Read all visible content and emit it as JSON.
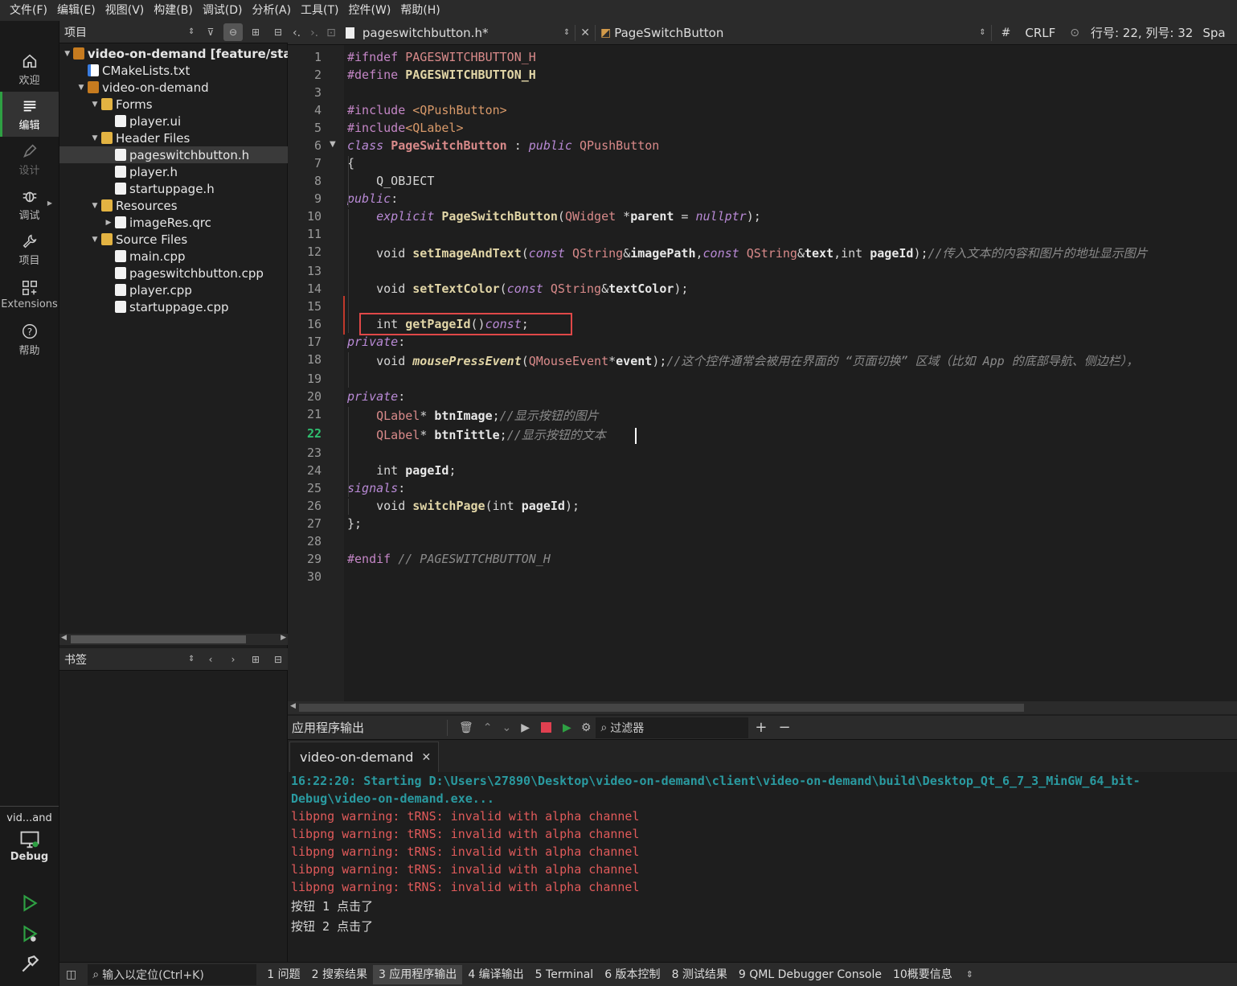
{
  "menubar": [
    "文件(F)",
    "编辑(E)",
    "视图(V)",
    "构建(B)",
    "调试(D)",
    "分析(A)",
    "工具(T)",
    "控件(W)",
    "帮助(H)"
  ],
  "modes": {
    "welcome": "欢迎",
    "edit": "编辑",
    "design": "设计",
    "debug": "调试",
    "project": "项目",
    "extensions": "Extensions",
    "help": "帮助"
  },
  "kit": {
    "name": "vid...and",
    "build": "Debug"
  },
  "project_panel": {
    "title": "项目",
    "tree": [
      {
        "label": "video-on-demand [feature/star",
        "icon": "project-icon",
        "depth": 0,
        "twisty": "▼",
        "bold": true
      },
      {
        "label": "CMakeLists.txt",
        "icon": "cmake-icon",
        "depth": 1,
        "twisty": ""
      },
      {
        "label": "video-on-demand",
        "icon": "hammer-icon",
        "depth": 1,
        "twisty": "▼"
      },
      {
        "label": "Forms",
        "icon": "folder-icon",
        "depth": 2,
        "twisty": "▼"
      },
      {
        "label": "player.ui",
        "icon": "file-icon",
        "depth": 3,
        "twisty": ""
      },
      {
        "label": "Header Files",
        "icon": "folder-icon",
        "depth": 2,
        "twisty": "▼"
      },
      {
        "label": "pageswitchbutton.h",
        "icon": "file-icon",
        "depth": 3,
        "twisty": "",
        "selected": true
      },
      {
        "label": "player.h",
        "icon": "file-icon",
        "depth": 3,
        "twisty": ""
      },
      {
        "label": "startuppage.h",
        "icon": "file-icon",
        "depth": 3,
        "twisty": ""
      },
      {
        "label": "Resources",
        "icon": "folder-icon",
        "depth": 2,
        "twisty": "▼"
      },
      {
        "label": "imageRes.qrc",
        "icon": "file-icon",
        "depth": 3,
        "twisty": "▶"
      },
      {
        "label": "Source Files",
        "icon": "folder-icon",
        "depth": 2,
        "twisty": "▼"
      },
      {
        "label": "main.cpp",
        "icon": "file-icon",
        "depth": 3,
        "twisty": ""
      },
      {
        "label": "pageswitchbutton.cpp",
        "icon": "file-icon",
        "depth": 3,
        "twisty": ""
      },
      {
        "label": "player.cpp",
        "icon": "file-icon",
        "depth": 3,
        "twisty": ""
      },
      {
        "label": "startuppage.cpp",
        "icon": "file-icon",
        "depth": 3,
        "twisty": ""
      }
    ]
  },
  "bookmarks_panel": {
    "title": "书签"
  },
  "editor_toolbar": {
    "file": "pageswitchbutton.h*",
    "symbol": "PageSwitchButton",
    "hash": "#",
    "line_ending": "CRLF",
    "position": "行号: 22, 列号: 32",
    "indent": "Spa"
  },
  "editor": {
    "current_line": 22,
    "lines": [
      "<span class=\"pp\">#ifndef</span> <span class=\"mac\">PAGESWITCHBUTTON_H</span>",
      "<span class=\"pp\">#define</span> <span class=\"fn\">PAGESWITCHBUTTON_H</span>",
      "",
      "<span class=\"pp\">#include</span> <span class=\"str\">&lt;QPushButton&gt;</span>",
      "<span class=\"pp\">#include</span><span class=\"str\">&lt;QLabel&gt;</span>",
      "<span class=\"kwi\">class</span> <span class=\"cl\">PageSwitchButton</span> : <span class=\"kwi\">public</span> <span class=\"ty\">QPushButton</span>",
      "{",
      "    Q_OBJECT",
      "<span class=\"kwi\">public</span>:",
      "    <span class=\"kwi\">explicit</span> <span class=\"fn\">PageSwitchButton</span>(<span class=\"ty\">QWidget</span> *<span class=\"pa\">parent</span> = <span class=\"kwi\">nullptr</span>);",
      "",
      "    void <span class=\"fn\">setImageAndText</span>(<span class=\"kwi\">const</span> <span class=\"ty\">QString</span>&amp;<span class=\"pa\">imagePath</span>,<span class=\"kwi\">const</span> <span class=\"ty\">QString</span>&amp;<span class=\"pa\">text</span>,int <span class=\"pa\">pageId</span>);<span class=\"cm\">//传入文本的内容和图片的地址显示图片</span>",
      "",
      "    void <span class=\"fn\">setTextColor</span>(<span class=\"kwi\">const</span> <span class=\"ty\">QString</span>&amp;<span class=\"pa\">textColor</span>);",
      "",
      "    int <span class=\"fn\">getPageId</span>()<span class=\"kwi\">const</span>;",
      "<span class=\"kwi\">private</span>:",
      "    void <span class=\"fni\">mousePressEvent</span>(<span class=\"ty\">QMouseEvent</span>*<span class=\"pa\">event</span>);<span class=\"cm\">//这个控件通常会被用在界面的 “页面切换” 区域（比如 App 的底部导航、侧边栏），</span>",
      "",
      "<span class=\"kwi\">private</span>:",
      "    <span class=\"ty\">QLabel</span>* <span class=\"pa\">btnImage</span>;<span class=\"cm\">//显示按钮的图片</span>",
      "    <span class=\"ty\">QLabel</span>* <span class=\"pa\">btnTittle</span>;<span class=\"cm\">//显示按钮的文本</span>",
      "",
      "    int <span class=\"pa\">pageId</span>;",
      "<span class=\"kwi\">signals</span>:",
      "    void <span class=\"fn\">switchPage</span>(int <span class=\"pa\">pageId</span>);",
      "};",
      "",
      "<span class=\"pp\">#endif</span> <span class=\"cm\">// PAGESWITCHBUTTON_H</span>",
      ""
    ]
  },
  "output": {
    "title": "应用程序输出",
    "filter_placeholder": "过滤器",
    "tab": "video-on-demand",
    "lines": [
      {
        "kind": "start",
        "text": "16:22:20: Starting D:\\Users\\27890\\Desktop\\video-on-demand\\client\\video-on-demand\\build\\Desktop_Qt_6_7_3_MinGW_64_bit-"
      },
      {
        "kind": "start",
        "text": "Debug\\video-on-demand.exe..."
      },
      {
        "kind": "warn",
        "text": "libpng warning: tRNS: invalid with alpha channel"
      },
      {
        "kind": "warn",
        "text": "libpng warning: tRNS: invalid with alpha channel"
      },
      {
        "kind": "warn",
        "text": "libpng warning: tRNS: invalid with alpha channel"
      },
      {
        "kind": "warn",
        "text": "libpng warning: tRNS: invalid with alpha channel"
      },
      {
        "kind": "warn",
        "text": "libpng warning: tRNS: invalid with alpha channel"
      },
      {
        "kind": "norm",
        "text": "按钮 1 点击了"
      },
      {
        "kind": "norm",
        "text": "按钮 2 点击了"
      }
    ]
  },
  "statusbar": {
    "locator_placeholder": "输入以定位(Ctrl+K)",
    "tabs": [
      "1 问题",
      "2 搜索结果",
      "3 应用程序输出",
      "4 编译输出",
      "5 Terminal",
      "6 版本控制",
      "8 测试结果",
      "9 QML Debugger Console",
      "10概要信息"
    ],
    "active_tab": 2
  },
  "colors": {
    "accent_green": "#2ea043",
    "highlight_red": "#e04848",
    "stop_red": "#e04050"
  }
}
